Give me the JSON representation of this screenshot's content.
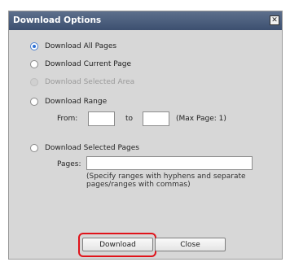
{
  "dialog": {
    "title": "Download Options",
    "close_glyph": "✕",
    "options": [
      {
        "label": "Download All Pages",
        "checked": true,
        "disabled": false
      },
      {
        "label": "Download Current Page",
        "checked": false,
        "disabled": false
      },
      {
        "label": "Download Selected Area",
        "checked": false,
        "disabled": true
      },
      {
        "label": "Download Range",
        "checked": false,
        "disabled": false
      },
      {
        "label": "Download Selected Pages",
        "checked": false,
        "disabled": false
      }
    ],
    "range": {
      "from_label": "From:",
      "from_value": "",
      "to_label": "to",
      "to_value": "",
      "max_page_text": "(Max Page: 1)"
    },
    "pages": {
      "label": "Pages:",
      "value": "",
      "hint": "(Specify ranges with hyphens and separate pages/ranges with commas)"
    },
    "buttons": {
      "download_label": "Download",
      "close_label": "Close"
    }
  },
  "colors": {
    "titlebar": "#4a5c7c",
    "highlight": "#e0131a",
    "dialog_bg": "#d7d7d7"
  }
}
